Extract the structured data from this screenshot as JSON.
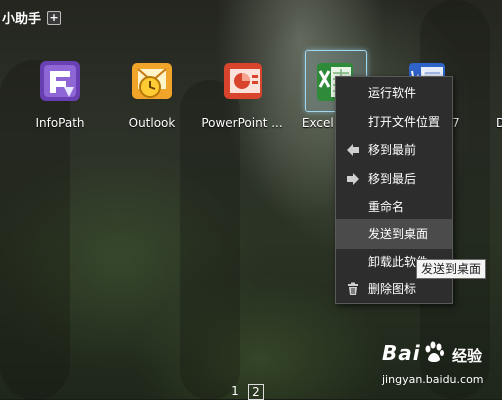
{
  "header": {
    "title": "小助手",
    "add_icon": "plus-icon"
  },
  "apps": [
    {
      "label": "InfoPath",
      "icon": "infopath-icon"
    },
    {
      "label": "Outlook",
      "icon": "outlook-icon"
    },
    {
      "label": "PowerPoint ...",
      "icon": "powerpoint-icon"
    },
    {
      "label": "Excel 2007",
      "icon": "excel-icon"
    },
    {
      "label": "Word 2007",
      "icon": "word-icon"
    },
    {
      "label": "D",
      "icon": "app-icon"
    }
  ],
  "context_menu": {
    "items": [
      {
        "label": "运行软件",
        "icon": ""
      },
      {
        "label": "打开文件位置",
        "icon": ""
      },
      {
        "label": "移到最前",
        "icon": "arrow-left-icon"
      },
      {
        "label": "移到最后",
        "icon": "arrow-right-icon"
      },
      {
        "label": "重命名",
        "icon": ""
      },
      {
        "label": "发送到桌面",
        "icon": ""
      },
      {
        "label": "卸载此软件",
        "icon": ""
      },
      {
        "label": "删除图标",
        "icon": "trash-icon"
      }
    ],
    "highlighted_index": 5
  },
  "tooltip": {
    "text": "发送到桌面"
  },
  "pagination": {
    "pages": [
      "1",
      "2"
    ],
    "current": "2"
  },
  "watermark": {
    "brand": "Bai",
    "suffix": "经验",
    "url": "jingyan.baidu.com"
  },
  "colors": {
    "selection_border": "#9fd8f2",
    "menu_bg": "#2d2d2d",
    "menu_highlight": "#4b4b4b"
  }
}
